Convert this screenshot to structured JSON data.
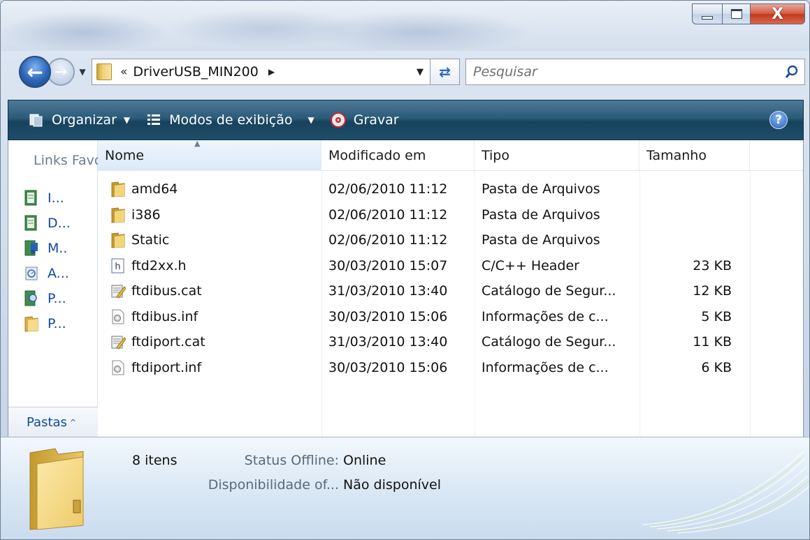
{
  "window": {
    "buttons": {
      "minimize": "minimize",
      "maximize": "maximize",
      "close": "X"
    }
  },
  "address": {
    "prefix": "«",
    "path": "DriverUSB_MIN200",
    "search_placeholder": "Pesquisar"
  },
  "toolbar": {
    "organize": "Organizar",
    "views": "Modos de exibição",
    "burn": "Gravar",
    "help": "?"
  },
  "navpane": {
    "header": "Links Favoritos",
    "items": [
      {
        "label": "I...",
        "icon": "document-icon"
      },
      {
        "label": "D...",
        "icon": "document-icon"
      },
      {
        "label": "M..",
        "icon": "music-icon"
      },
      {
        "label": "A...",
        "icon": "recent-icon"
      },
      {
        "label": "P...",
        "icon": "search-folder-icon"
      },
      {
        "label": "P...",
        "icon": "folder-icon"
      }
    ],
    "folders_label": "Pastas",
    "folders_arrow": "^"
  },
  "columns": {
    "name": "Nome",
    "modified": "Modificado em",
    "type": "Tipo",
    "size": "Tamanho"
  },
  "files": [
    {
      "name": "amd64",
      "modified": "02/06/2010 11:12",
      "type": "Pasta de Arquivos",
      "size": "",
      "icon": "folder"
    },
    {
      "name": "i386",
      "modified": "02/06/2010 11:12",
      "type": "Pasta de Arquivos",
      "size": "",
      "icon": "folder"
    },
    {
      "name": "Static",
      "modified": "02/06/2010 11:12",
      "type": "Pasta de Arquivos",
      "size": "",
      "icon": "folder"
    },
    {
      "name": "ftd2xx.h",
      "modified": "30/03/2010 15:07",
      "type": "C/C++ Header",
      "size": "23 KB",
      "icon": "header"
    },
    {
      "name": "ftdibus.cat",
      "modified": "31/03/2010 13:40",
      "type": "Catálogo de Segur...",
      "size": "12 KB",
      "icon": "catalog"
    },
    {
      "name": "ftdibus.inf",
      "modified": "30/03/2010 15:06",
      "type": "Informações de c...",
      "size": "5 KB",
      "icon": "inf"
    },
    {
      "name": "ftdiport.cat",
      "modified": "31/03/2010 13:40",
      "type": "Catálogo de Segur...",
      "size": "11 KB",
      "icon": "catalog"
    },
    {
      "name": "ftdiport.inf",
      "modified": "30/03/2010 15:06",
      "type": "Informações de c...",
      "size": "6 KB",
      "icon": "inf"
    }
  ],
  "details": {
    "count": "8 itens",
    "offline_label": "Status Offline:",
    "offline_value": "Online",
    "availability_label": "Disponibilidade of...",
    "availability_value": "Não disponível"
  }
}
